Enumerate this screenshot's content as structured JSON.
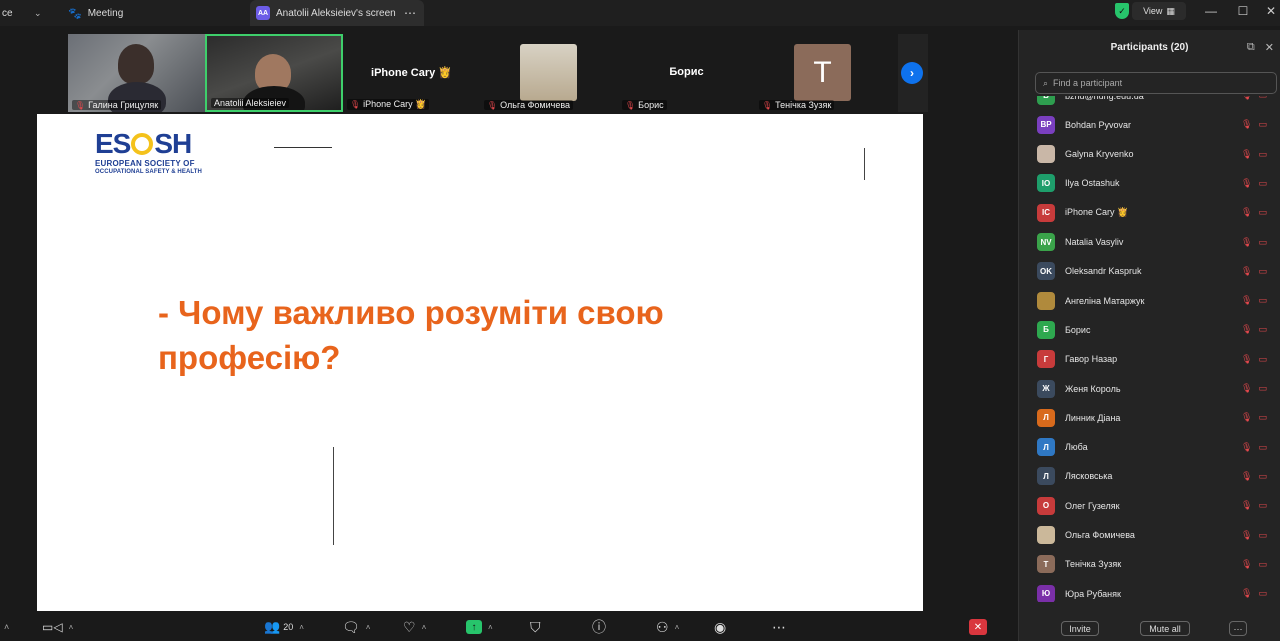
{
  "topbar": {
    "app_name_fragment": "ce",
    "meeting_tab": "Meeting",
    "share_tab": "Anatolii Aleksieiev's screen",
    "share_badge": "AA",
    "view_label": "View"
  },
  "strip": {
    "tiles": [
      {
        "name": "Галина Грицуляк"
      },
      {
        "name": "Anatolii Aleksieiev"
      },
      {
        "name": "iPhone Cary 👸",
        "center": "iPhone  Cary 👸"
      },
      {
        "name": "Ольга Фомичева"
      },
      {
        "name": "Борис",
        "center": "Борис"
      },
      {
        "name": "Тенічка Зузяк",
        "initial": "T"
      }
    ]
  },
  "slide": {
    "logo_word_left": "ES",
    "logo_word_right": "SH",
    "logo_line1": "EUROPEAN SOCIETY OF",
    "logo_line2": "OCCUPATIONAL SAFETY & HEALTH",
    "heading": "- Чому важливо розуміти свою професію?"
  },
  "toolbar": {
    "participants_count": "20"
  },
  "panel": {
    "title": "Participants (20)",
    "search_placeholder": "Find a participant",
    "participants": [
      {
        "initials": "B",
        "name": "bzhd@nung.edu.ua",
        "color": "#2e9e4f"
      },
      {
        "initials": "BP",
        "name": "Bohdan Pyvovar",
        "color": "#7a3fbf"
      },
      {
        "initials": "",
        "name": "Galyna Kryvenko",
        "color": "#c9b7a7"
      },
      {
        "initials": "IO",
        "name": "Ilya Ostashuk",
        "color": "#1e9e6b"
      },
      {
        "initials": "IC",
        "name": "iPhone Cary 👸",
        "color": "#c73b3b"
      },
      {
        "initials": "NV",
        "name": "Natalia Vasyliv",
        "color": "#3aa34a"
      },
      {
        "initials": "OK",
        "name": "Oleksandr Kaspruk",
        "color": "#3b4a5e"
      },
      {
        "initials": "",
        "name": "Ангеліна Матаржук",
        "color": "#b08a3c"
      },
      {
        "initials": "Б",
        "name": "Борис",
        "color": "#2ea84f"
      },
      {
        "initials": "Г",
        "name": "Гавор Назар",
        "color": "#c73b3b"
      },
      {
        "initials": "Ж",
        "name": "Женя Король",
        "color": "#3b4a5e"
      },
      {
        "initials": "Л",
        "name": "Линник Діана",
        "color": "#d86a1c"
      },
      {
        "initials": "Л",
        "name": "Люба",
        "color": "#2f78c4"
      },
      {
        "initials": "Л",
        "name": "Лясковська",
        "color": "#3b4a5e"
      },
      {
        "initials": "О",
        "name": "Олег Гузеляк",
        "color": "#c73b3b"
      },
      {
        "initials": "",
        "name": "Ольга Фомичева",
        "color": "#cbb89a"
      },
      {
        "initials": "T",
        "name": "Тенічка Зузяк",
        "color": "#8b6b5a"
      },
      {
        "initials": "Ю",
        "name": "Юра Рубаняк",
        "color": "#7a2fa8"
      }
    ],
    "invite_label": "Invite",
    "mute_all_label": "Mute all",
    "more_label": "···"
  }
}
